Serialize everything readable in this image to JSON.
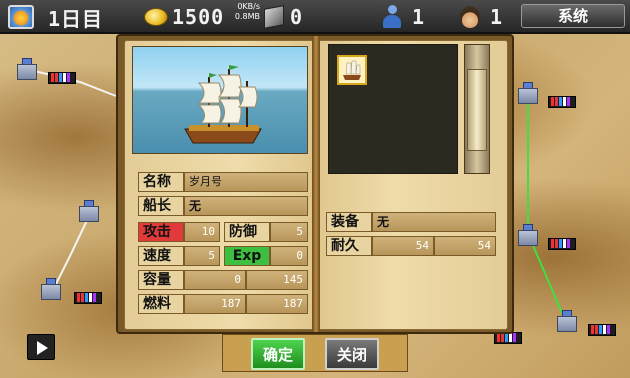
{
  "topbar": {
    "day_icon": "sun-icon",
    "day": "1日目",
    "coin_icon": "coin-icon",
    "coins": "1500",
    "net_speed": "0KB/s",
    "net_total": "0.8MB",
    "cube_icon": "cube-icon",
    "cubes": "0",
    "person_icon": "person-icon",
    "persons": "1",
    "sailor_icon": "sailor-icon",
    "sailors": "1",
    "system_label": "系统"
  },
  "ship": {
    "name_label": "名称",
    "name_value": "岁月号",
    "captain_label": "船长",
    "captain_value": "无",
    "attack_label": "攻击",
    "attack_value": "10",
    "defense_label": "防御",
    "defense_value": "5",
    "speed_label": "速度",
    "speed_value": "5",
    "exp_label": "Exp",
    "exp_value": "0",
    "capacity_label": "容量",
    "capacity_current": "0",
    "capacity_max": "145",
    "fuel_label": "燃料",
    "fuel_current": "187",
    "fuel_max": "187",
    "equip_label": "装备",
    "equip_value": "无",
    "durability_label": "耐久",
    "durability_current": "54",
    "durability_max": "54"
  },
  "buttons": {
    "confirm": "确定",
    "close": "关闭"
  },
  "colors": {
    "attack_red": "#e23a3a",
    "exp_green": "#3fbf3f",
    "route_green": "#3fe03f",
    "route_white": "#f4f4f4"
  }
}
